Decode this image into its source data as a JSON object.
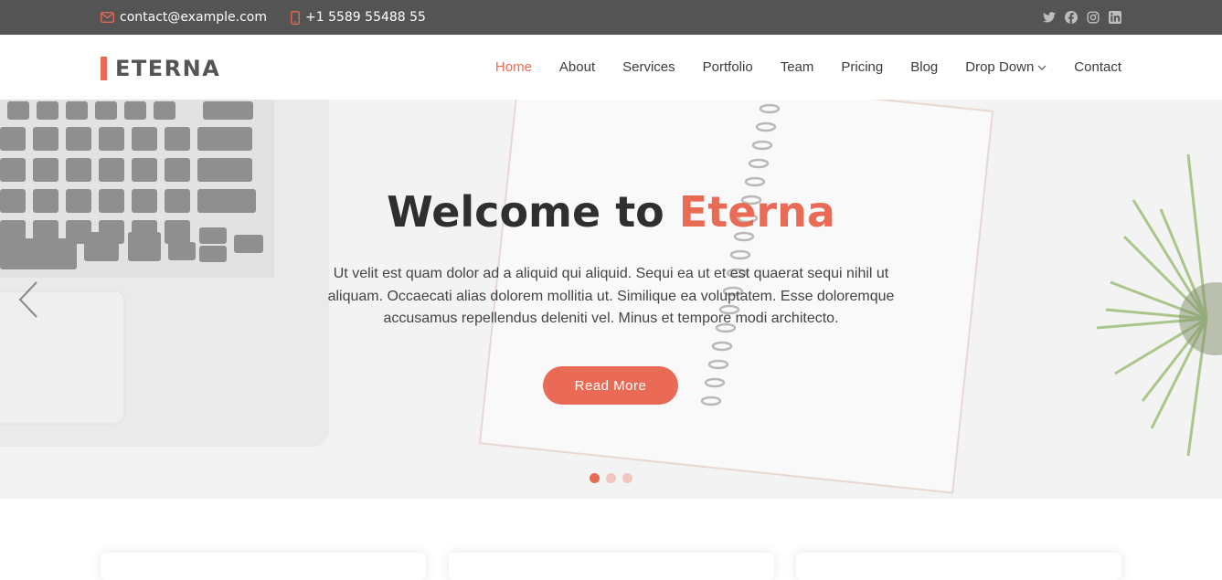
{
  "topbar": {
    "email": "contact@example.com",
    "phone": "+1 5589 55488 55",
    "social": [
      "twitter-icon",
      "facebook-icon",
      "instagram-icon",
      "linkedin-icon"
    ]
  },
  "header": {
    "logo": "ETERNA",
    "nav": [
      {
        "label": "Home",
        "active": true
      },
      {
        "label": "About"
      },
      {
        "label": "Services"
      },
      {
        "label": "Portfolio"
      },
      {
        "label": "Team"
      },
      {
        "label": "Pricing"
      },
      {
        "label": "Blog"
      },
      {
        "label": "Drop Down",
        "dropdown": true
      },
      {
        "label": "Contact"
      }
    ]
  },
  "hero": {
    "title_prefix": "Welcome to ",
    "title_accent": "Eterna",
    "text": "Ut velit est quam dolor ad a aliquid qui aliquid. Sequi ea ut et est quaerat sequi nihil ut aliquam. Occaecati alias dolorem mollitia ut. Similique ea voluptatem. Esse doloremque accusamus repellendus deleniti vel. Minus et tempore modi architecto.",
    "button": "Read More",
    "slides": 3,
    "active_slide": 1
  },
  "colors": {
    "accent": "#e96b56",
    "topbar": "#545454",
    "text_dark": "#2f2f2f"
  }
}
